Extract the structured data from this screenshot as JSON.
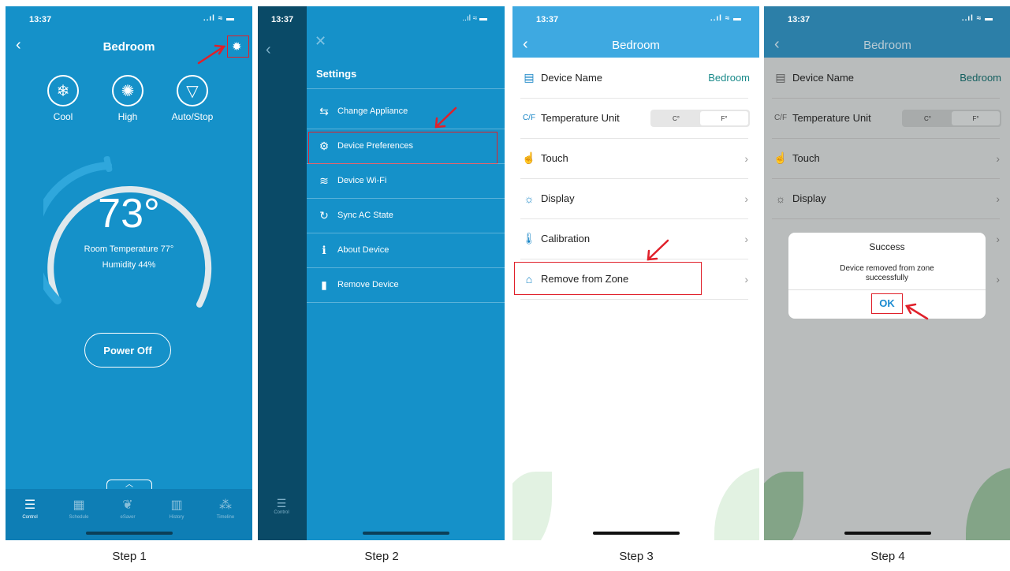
{
  "status": {
    "time": "13:37",
    "icons": "..ıl ≈ ▬"
  },
  "step1": {
    "title": "Bedroom",
    "modes": [
      {
        "label": "Cool",
        "icon": "❄"
      },
      {
        "label": "High",
        "icon": "✺"
      },
      {
        "label": "Auto/Stop",
        "icon": "▽"
      }
    ],
    "temperature": "73°",
    "room_temperature": "Room Temperature 77°",
    "humidity": "Humidity 44%",
    "power_button": "Power Off",
    "tabs": [
      {
        "label": "Control",
        "icon": "☰"
      },
      {
        "label": "Schedule",
        "icon": "▦"
      },
      {
        "label": "eSaver",
        "icon": "❦"
      },
      {
        "label": "History",
        "icon": "▥"
      },
      {
        "label": "Timeline",
        "icon": "⁂"
      }
    ]
  },
  "step2": {
    "title": "Settings",
    "close_icon": "✕",
    "strip_tab": "Control",
    "items": [
      {
        "label": "Change Appliance",
        "icon": "⇆"
      },
      {
        "label": "Device Preferences",
        "icon": "⚙"
      },
      {
        "label": "Device Wi-Fi",
        "icon": "≋"
      },
      {
        "label": "Sync AC State",
        "icon": "↻"
      },
      {
        "label": "About Device",
        "icon": "ℹ"
      },
      {
        "label": "Remove Device",
        "icon": "▮"
      }
    ]
  },
  "step3": {
    "title": "Bedroom",
    "rows": [
      {
        "label": "Device Name",
        "value": "Bedroom",
        "icon": "▤"
      },
      {
        "label": "Temperature Unit",
        "icon": "C/F"
      },
      {
        "label": "Touch",
        "icon": "☝"
      },
      {
        "label": "Display",
        "icon": "☼"
      },
      {
        "label": "Calibration",
        "icon": "🌡"
      },
      {
        "label": "Remove from Zone",
        "icon": "⌂"
      }
    ],
    "units": [
      "C°",
      "F°"
    ]
  },
  "step4": {
    "title": "Bedroom",
    "dialog_title": "Success",
    "dialog_message": "Device removed from zone successfully",
    "ok_label": "OK"
  },
  "steps": [
    "Step 1",
    "Step 2",
    "Step 3",
    "Step 4"
  ]
}
